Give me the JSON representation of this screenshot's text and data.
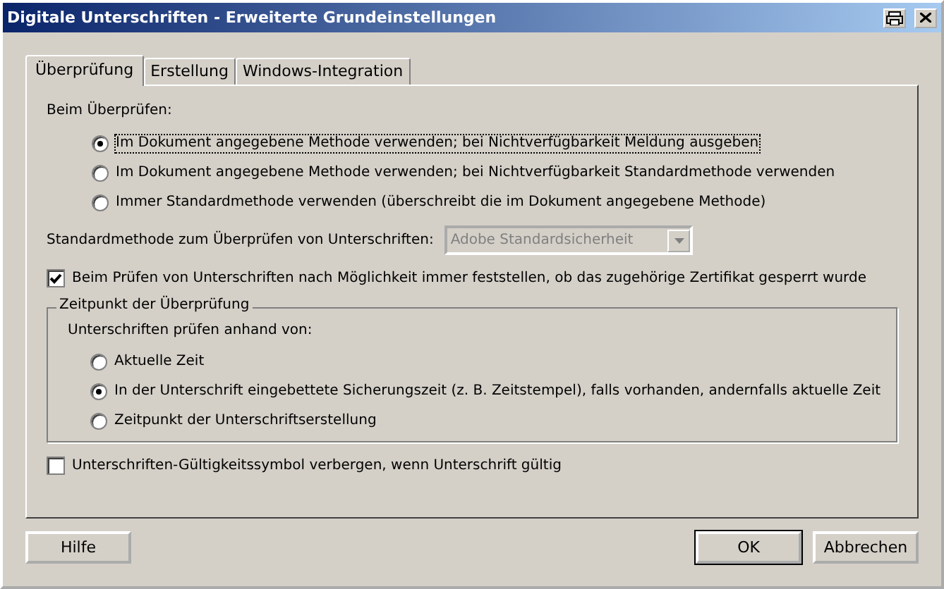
{
  "window": {
    "title": "Digitale Unterschriften - Erweiterte Grundeinstellungen"
  },
  "tabs": [
    {
      "label": "Überprüfung",
      "selected": true
    },
    {
      "label": "Erstellung",
      "selected": false
    },
    {
      "label": "Windows-Integration",
      "selected": false
    }
  ],
  "verify_heading": "Beim Überprüfen:",
  "verify_options": [
    {
      "label": "Im Dokument angegebene Methode verwenden; bei Nichtverfügbarkeit Meldung ausgeben",
      "selected": true
    },
    {
      "label": "Im Dokument angegebene Methode verwenden; bei Nichtverfügbarkeit Standardmethode verwenden",
      "selected": false
    },
    {
      "label": "Immer Standardmethode verwenden (überschreibt die im Dokument angegebene Methode)",
      "selected": false
    }
  ],
  "default_method": {
    "label": "Standardmethode zum Überprüfen von Unterschriften:",
    "value": "Adobe Standardsicherheit",
    "disabled": true
  },
  "revocation_check": {
    "label": "Beim Prüfen von Unterschriften nach Möglichkeit immer feststellen, ob das zugehörige Zertifikat gesperrt wurde",
    "checked": true
  },
  "time_group": {
    "title": "Zeitpunkt der Überprüfung",
    "heading": "Unterschriften prüfen anhand von:",
    "options": [
      {
        "label": "Aktuelle Zeit",
        "selected": false
      },
      {
        "label": "In der Unterschrift eingebettete Sicherungszeit (z. B. Zeitstempel), falls vorhanden, andernfalls aktuelle Zeit",
        "selected": true
      },
      {
        "label": "Zeitpunkt der Unterschriftserstellung",
        "selected": false
      }
    ]
  },
  "hide_icon": {
    "label": "Unterschriften-Gültigkeitssymbol verbergen, wenn Unterschrift gültig",
    "checked": false
  },
  "buttons": {
    "help": "Hilfe",
    "ok": "OK",
    "cancel": "Abbrechen"
  }
}
